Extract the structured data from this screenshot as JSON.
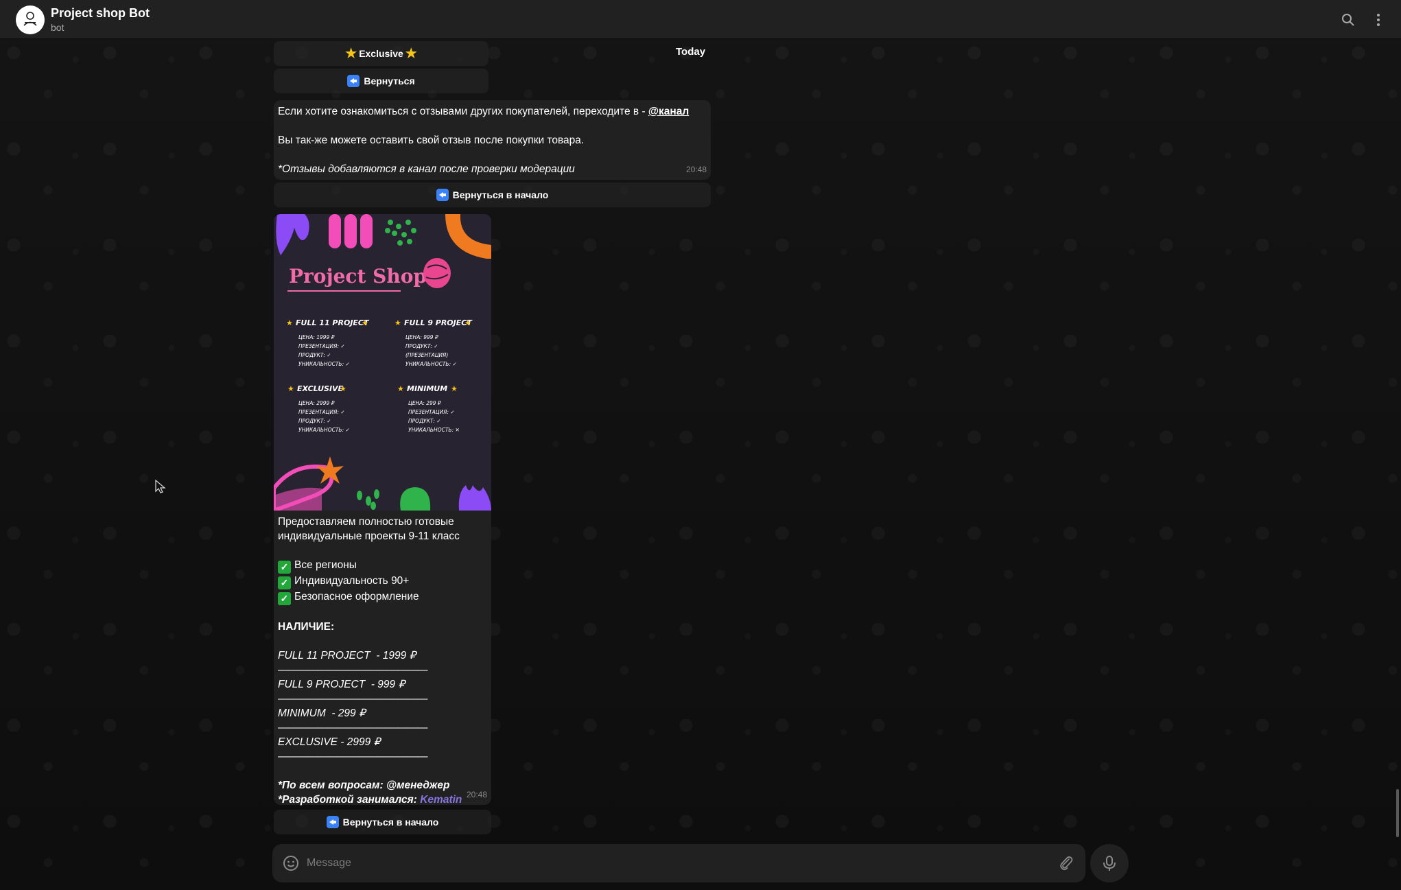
{
  "header": {
    "title": "Project shop Bot",
    "subtitle": "bot"
  },
  "date_label": "Today",
  "keyboard_top": {
    "exclusive": "Exclusive",
    "back": "Вернуться"
  },
  "reviews_message": {
    "line1_text": "Если хотите ознакомиться с отзывами других покупателей, переходите в - ",
    "line1_link": "@канал",
    "line2": "Вы так-же можете оставить свой отзыв после покупки товара.",
    "line3": "*Отзывы добавляются в канал после проверки модерации",
    "time": "20:48"
  },
  "back_to_start_1": "Вернуться в начало",
  "poster": {
    "title": "Project Shop",
    "products": [
      {
        "name": "FULL 11 PROJECT",
        "lines": [
          "ЦЕНА: 1999 ₽",
          "ПРЕЗЕНТАЦИЯ: ✓",
          "ПРОДУКТ: ✓",
          "УНИКАЛЬНОСТЬ: ✓"
        ]
      },
      {
        "name": "FULL 9 PROJECT",
        "lines": [
          "ЦЕНА: 999 ₽",
          "ПРОДУКТ: ✓",
          "(ПРЕЗЕНТАЦИЯ)",
          "УНИКАЛЬНОСТЬ: ✓"
        ]
      },
      {
        "name": "EXCLUSIVE",
        "lines": [
          "ЦЕНА: 2999 ₽",
          "ПРЕЗЕНТАЦИЯ: ✓",
          "ПРОДУКТ: ✓",
          "УНИКАЛЬНОСТЬ: ✓"
        ]
      },
      {
        "name": "MINIMUM",
        "lines": [
          "ЦЕНА: 299 ₽",
          "ПРЕЗЕНТАЦИЯ: ✓",
          "ПРОДУКТ: ✓",
          "УНИКАЛЬНОСТЬ: ✕"
        ]
      }
    ]
  },
  "shop_message": {
    "intro1": "Предоставляем полностью готовые",
    "intro2": "индивидуальные проекты 9-11 класс",
    "features": [
      "Все регионы",
      "Индивидуальность 90+",
      "Безопасное оформление"
    ],
    "availability": "НАЛИЧИЕ:",
    "items": [
      "FULL 11 PROJECT  - 1999 ₽",
      "FULL 9 PROJECT  - 999 ₽",
      "MINIMUM  - 299 ₽",
      "EXCLUSIVE - 2999 ₽"
    ],
    "separator": "———————————————",
    "questions": "*По всем вопросам: @менеджер",
    "dev_prefix": "*Разработкой занимался: ",
    "dev_link": "Kematin",
    "time": "20:48"
  },
  "back_to_start_2": "Вернуться в начало",
  "composer": {
    "placeholder": "Message"
  }
}
